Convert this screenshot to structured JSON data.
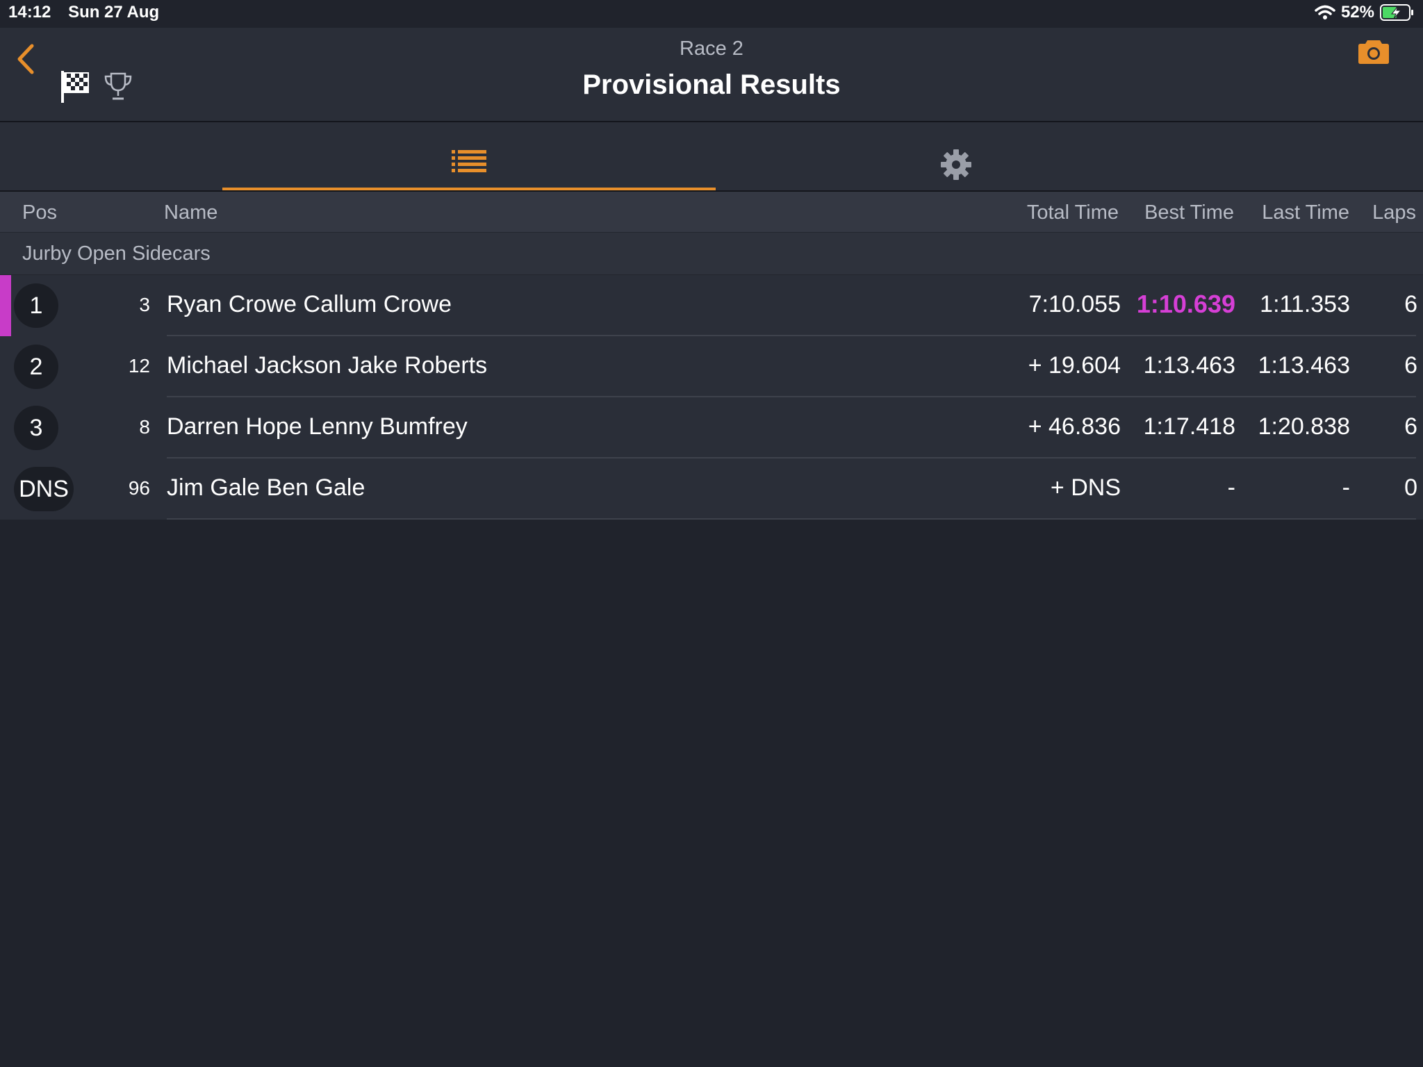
{
  "status_bar": {
    "time": "14:12",
    "date": "Sun 27 Aug",
    "battery": "52%"
  },
  "header": {
    "subtitle": "Race 2",
    "title": "Provisional Results"
  },
  "icons": {
    "back": "chevron-left-icon",
    "flag": "checkered-flag-icon",
    "trophy": "trophy-icon",
    "camera": "camera-icon",
    "list": "list-icon",
    "settings": "gear-icon"
  },
  "colors": {
    "accent": "#e88f2b",
    "best_lap": "#d63fd6",
    "background": "#20232c"
  },
  "columns": {
    "pos": "Pos",
    "name": "Name",
    "total": "Total Time",
    "best": "Best Time",
    "last": "Last Time",
    "laps": "Laps"
  },
  "group": "Jurby Open Sidecars",
  "rows": [
    {
      "pos": "1",
      "num": "3",
      "name": "Ryan Crowe Callum Crowe",
      "total": "7:10.055",
      "best": "1:10.639",
      "last": "1:11.353",
      "laps": "6"
    },
    {
      "pos": "2",
      "num": "12",
      "name": "Michael Jackson Jake Roberts",
      "total": "+ 19.604",
      "best": "1:13.463",
      "last": "1:13.463",
      "laps": "6"
    },
    {
      "pos": "3",
      "num": "8",
      "name": "Darren Hope Lenny Bumfrey",
      "total": "+ 46.836",
      "best": "1:17.418",
      "last": "1:20.838",
      "laps": "6"
    },
    {
      "pos": "DNS",
      "num": "96",
      "name": "Jim Gale Ben Gale",
      "total": "+ DNS",
      "best": "-",
      "last": "-",
      "laps": "0"
    }
  ]
}
